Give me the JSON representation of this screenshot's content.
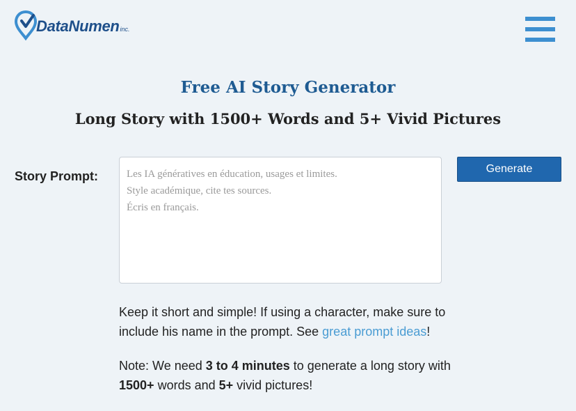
{
  "header": {
    "logo_text": "DataNumen",
    "logo_suffix": "inc.",
    "menu_icon": "hamburger-menu-icon",
    "brand_color": "#1e4f8a",
    "accent_color": "#3d8fd0"
  },
  "main": {
    "title": "Free AI Story Generator",
    "subtitle": "Long Story with 1500+ Words and 5+ Vivid Pictures",
    "prompt_label": "Story Prompt:",
    "prompt_placeholder": "Les IA génératives en éducation, usages et limites.\nStyle académique, cite tes sources.\nÉcris en français.",
    "generate_label": "Generate",
    "generate_color": "#2067ae",
    "hint": {
      "text_before": "Keep it short and simple! If using a character, make sure to include his name in the prompt. See ",
      "link_text": "great prompt ideas",
      "text_after": "!"
    },
    "note": {
      "prefix": "Note: We need ",
      "duration": "3 to 4 minutes",
      "middle": " to generate a long story with ",
      "words": "1500+",
      "middle2": " words and ",
      "pictures": "5+",
      "suffix": " vivid pictures!"
    }
  }
}
